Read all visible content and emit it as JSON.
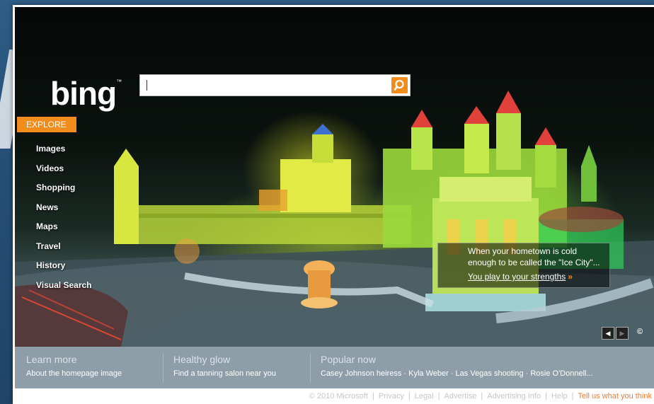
{
  "brand": {
    "logo": "bing",
    "tm": "™"
  },
  "search": {
    "value": "",
    "placeholder": ""
  },
  "explore_label": "EXPLORE",
  "nav": [
    "Images",
    "Videos",
    "Shopping",
    "News",
    "Maps",
    "Travel",
    "History",
    "Visual Search"
  ],
  "caption": {
    "text": "When your hometown is cold enough to be called the \"Ice City\"...",
    "link": "You play to your strengths",
    "arrow": "»"
  },
  "image_nav": {
    "prev": "◀",
    "next": "▶",
    "copyright": "©"
  },
  "bottom": {
    "col1": {
      "heading": "Learn more",
      "text": "About the homepage image"
    },
    "col2": {
      "heading": "Healthy glow",
      "text": "Find a tanning salon near you"
    },
    "col3": {
      "heading": "Popular now",
      "text": "Casey Johnson heiress · Kyla Weber · Las Vegas shooting · Rosie O'Donnell..."
    }
  },
  "footer": {
    "copyright": "© 2010 Microsoft",
    "links": [
      "Privacy",
      "Legal",
      "Advertise",
      "Advertising Info",
      "Help"
    ],
    "feedback": "Tell us what you think"
  },
  "colors": {
    "accent": "#f28c1a",
    "bottom_bar": "#8d9ea8",
    "page_bg": "#2a5780"
  },
  "icons": [
    "search-icon",
    "prev-arrow-icon",
    "next-arrow-icon",
    "copyright-icon"
  ]
}
